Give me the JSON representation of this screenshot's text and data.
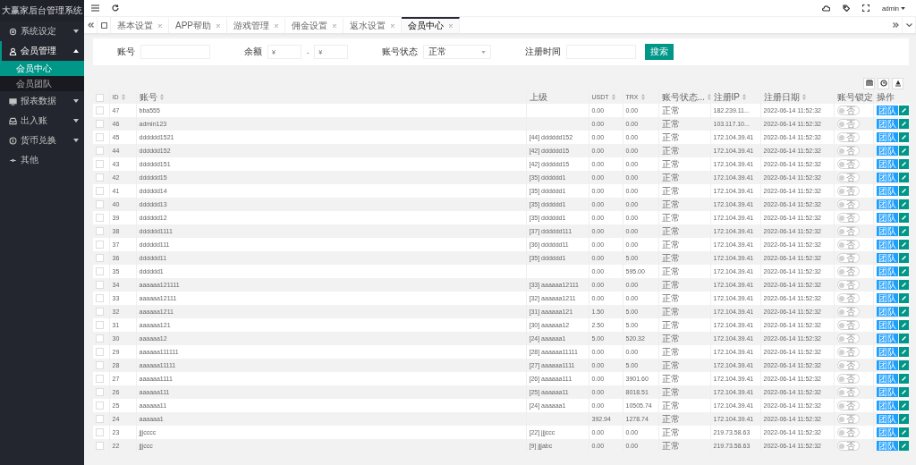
{
  "app": {
    "title": "大赢家后台管理系统"
  },
  "sidebar": {
    "items": [
      {
        "label": "系统设定",
        "kind": "group",
        "expanded": false
      },
      {
        "label": "会员管理",
        "kind": "group",
        "expanded": true,
        "children": [
          {
            "label": "会员中心",
            "selected": true
          },
          {
            "label": "会员团队",
            "selected": false
          }
        ]
      },
      {
        "label": "报表数据",
        "kind": "group",
        "expanded": false
      },
      {
        "label": "出入账",
        "kind": "group",
        "expanded": false
      },
      {
        "label": "货币兑换",
        "kind": "group",
        "expanded": false
      },
      {
        "label": "其他",
        "kind": "link"
      }
    ]
  },
  "header": {
    "user": "admin"
  },
  "tabs": [
    {
      "label": "基本设置",
      "selected": false
    },
    {
      "label": "APP帮助",
      "selected": false
    },
    {
      "label": "游戏管理",
      "selected": false
    },
    {
      "label": "佣金设置",
      "selected": false
    },
    {
      "label": "返水设置",
      "selected": false
    },
    {
      "label": "会员中心",
      "selected": true
    }
  ],
  "filter": {
    "fields": [
      {
        "label": "账号",
        "kind": "text"
      },
      {
        "label": "余额",
        "kind": "range",
        "from_placeholder": "¥",
        "separator": "-",
        "to_placeholder": "¥"
      },
      {
        "label": "账号状态",
        "kind": "select",
        "value": "正常"
      },
      {
        "label": "注册时间",
        "kind": "text"
      }
    ],
    "search_button": "搜索"
  },
  "table": {
    "header_checked": false,
    "columns": [
      {
        "label": "ID",
        "sortable": true
      },
      {
        "label": "账号",
        "sortable": true
      },
      {
        "label": "上级",
        "sortable": false
      },
      {
        "label": "USDT",
        "sortable": true
      },
      {
        "label": "TRX",
        "sortable": true
      },
      {
        "label": "账号状态...",
        "sortable": true
      },
      {
        "label": "注册IP",
        "sortable": true
      },
      {
        "label": "注册日期",
        "sortable": true
      },
      {
        "label": "账号锁定",
        "sortable": false
      },
      {
        "label": "操作",
        "sortable": false
      }
    ],
    "rows": [
      {
        "checked": false,
        "id": "47",
        "account": "bba555",
        "usdt": "0.00",
        "trx": "0.00",
        "status": "正常",
        "ip": "182.239.11...",
        "registered": "2022-06-14 11:52:32",
        "lock": {
          "on": false,
          "label": "否"
        },
        "action": "团队"
      },
      {
        "checked": false,
        "id": "46",
        "account": "admin123",
        "usdt": "0.00",
        "trx": "0.00",
        "status": "正常",
        "ip": "103.117.10...",
        "registered": "2022-06-14 11:52:32",
        "lock": {
          "on": false,
          "label": "否"
        },
        "action": "团队"
      },
      {
        "checked": false,
        "id": "45",
        "account": "dddddd1521",
        "upline": "[44] dddddd152",
        "usdt": "0.00",
        "trx": "0.00",
        "status": "正常",
        "ip": "172.104.39.41",
        "registered": "2022-06-14 11:52:32",
        "lock": {
          "on": false,
          "label": "否"
        },
        "action": "团队"
      },
      {
        "checked": false,
        "id": "44",
        "account": "dddddd152",
        "upline": "[42] dddddd15",
        "usdt": "0.00",
        "trx": "0.00",
        "status": "正常",
        "ip": "172.104.39.41",
        "registered": "2022-06-14 11:52:32",
        "lock": {
          "on": false,
          "label": "否"
        },
        "action": "团队"
      },
      {
        "checked": false,
        "id": "43",
        "account": "dddddd151",
        "upline": "[42] dddddd15",
        "usdt": "0.00",
        "trx": "0.00",
        "status": "正常",
        "ip": "172.104.39.41",
        "registered": "2022-06-14 11:52:32",
        "lock": {
          "on": false,
          "label": "否"
        },
        "action": "团队"
      },
      {
        "checked": false,
        "id": "42",
        "account": "dddddd15",
        "upline": "[35] dddddd1",
        "usdt": "0.00",
        "trx": "0.00",
        "status": "正常",
        "ip": "172.104.39.41",
        "registered": "2022-06-14 11:52:32",
        "lock": {
          "on": false,
          "label": "否"
        },
        "action": "团队"
      },
      {
        "checked": false,
        "id": "41",
        "account": "dddddd14",
        "upline": "[35] dddddd1",
        "usdt": "0.00",
        "trx": "0.00",
        "status": "正常",
        "ip": "172.104.39.41",
        "registered": "2022-06-14 11:52:32",
        "lock": {
          "on": false,
          "label": "否"
        },
        "action": "团队"
      },
      {
        "checked": false,
        "id": "40",
        "account": "dddddd13",
        "upline": "[35] dddddd1",
        "usdt": "0.00",
        "trx": "0.00",
        "status": "正常",
        "ip": "172.104.39.41",
        "registered": "2022-06-14 11:52:32",
        "lock": {
          "on": false,
          "label": "否"
        },
        "action": "团队"
      },
      {
        "checked": false,
        "id": "39",
        "account": "dddddd12",
        "upline": "[35] dddddd1",
        "usdt": "0.00",
        "trx": "0.00",
        "status": "正常",
        "ip": "172.104.39.41",
        "registered": "2022-06-14 11:52:32",
        "lock": {
          "on": false,
          "label": "否"
        },
        "action": "团队"
      },
      {
        "checked": false,
        "id": "38",
        "account": "dddddd1111",
        "upline": "[37] dddddd111",
        "usdt": "0.00",
        "trx": "0.00",
        "status": "正常",
        "ip": "172.104.39.41",
        "registered": "2022-06-14 11:52:32",
        "lock": {
          "on": false,
          "label": "否"
        },
        "action": "团队"
      },
      {
        "checked": false,
        "id": "37",
        "account": "dddddd111",
        "upline": "[36] dddddd11",
        "usdt": "0.00",
        "trx": "0.00",
        "status": "正常",
        "ip": "172.104.39.41",
        "registered": "2022-06-14 11:52:32",
        "lock": {
          "on": false,
          "label": "否"
        },
        "action": "团队"
      },
      {
        "checked": false,
        "id": "36",
        "account": "dddddd11",
        "upline": "[35] dddddd1",
        "usdt": "0.00",
        "trx": "5.00",
        "status": "正常",
        "ip": "172.104.39.41",
        "registered": "2022-06-14 11:52:32",
        "lock": {
          "on": false,
          "label": "否"
        },
        "action": "团队"
      },
      {
        "checked": false,
        "id": "35",
        "account": "dddddd1",
        "usdt": "0.00",
        "trx": "595.00",
        "status": "正常",
        "ip": "172.104.39.41",
        "registered": "2022-06-14 11:52:32",
        "lock": {
          "on": false,
          "label": "否"
        },
        "action": "团队"
      },
      {
        "checked": false,
        "id": "34",
        "account": "aaaaaa121111",
        "upline": "[33] aaaaaa12111",
        "usdt": "0.00",
        "trx": "0.00",
        "status": "正常",
        "ip": "172.104.39.41",
        "registered": "2022-06-14 11:52:32",
        "lock": {
          "on": false,
          "label": "否"
        },
        "action": "团队"
      },
      {
        "checked": false,
        "id": "33",
        "account": "aaaaaa12111",
        "upline": "[32] aaaaaa1211",
        "usdt": "0.00",
        "trx": "0.00",
        "status": "正常",
        "ip": "172.104.39.41",
        "registered": "2022-06-14 11:52:32",
        "lock": {
          "on": false,
          "label": "否"
        },
        "action": "团队"
      },
      {
        "checked": false,
        "id": "32",
        "account": "aaaaaa1211",
        "upline": "[31] aaaaaa121",
        "usdt": "1.50",
        "trx": "5.00",
        "status": "正常",
        "ip": "172.104.39.41",
        "registered": "2022-06-14 11:52:32",
        "lock": {
          "on": false,
          "label": "否"
        },
        "action": "团队"
      },
      {
        "checked": false,
        "id": "31",
        "account": "aaaaaa121",
        "upline": "[30] aaaaaa12",
        "usdt": "2.50",
        "trx": "5.00",
        "status": "正常",
        "ip": "172.104.39.41",
        "registered": "2022-06-14 11:52:32",
        "lock": {
          "on": false,
          "label": "否"
        },
        "action": "团队"
      },
      {
        "checked": false,
        "id": "30",
        "account": "aaaaaa12",
        "upline": "[24] aaaaaa1",
        "usdt": "5.00",
        "trx": "520.32",
        "status": "正常",
        "ip": "172.104.39.41",
        "registered": "2022-06-14 11:52:32",
        "lock": {
          "on": false,
          "label": "否"
        },
        "action": "团队"
      },
      {
        "checked": false,
        "id": "29",
        "account": "aaaaaa111111",
        "upline": "[28] aaaaaa11111",
        "usdt": "0.00",
        "trx": "0.00",
        "status": "正常",
        "ip": "172.104.39.41",
        "registered": "2022-06-14 11:52:32",
        "lock": {
          "on": false,
          "label": "否"
        },
        "action": "团队"
      },
      {
        "checked": false,
        "id": "28",
        "account": "aaaaaa11111",
        "upline": "[27] aaaaaa1111",
        "usdt": "0.00",
        "trx": "5.00",
        "status": "正常",
        "ip": "172.104.39.41",
        "registered": "2022-06-14 11:52:32",
        "lock": {
          "on": false,
          "label": "否"
        },
        "action": "团队"
      },
      {
        "checked": false,
        "id": "27",
        "account": "aaaaaa1111",
        "upline": "[26] aaaaaa111",
        "usdt": "0.00",
        "trx": "3901.60",
        "status": "正常",
        "ip": "172.104.39.41",
        "registered": "2022-06-14 11:52:32",
        "lock": {
          "on": false,
          "label": "否"
        },
        "action": "团队"
      },
      {
        "checked": false,
        "id": "26",
        "account": "aaaaaa111",
        "upline": "[25] aaaaaa11",
        "usdt": "0.00",
        "trx": "8018.51",
        "status": "正常",
        "ip": "172.104.39.41",
        "registered": "2022-06-14 11:52:32",
        "lock": {
          "on": false,
          "label": "否"
        },
        "action": "团队"
      },
      {
        "checked": false,
        "id": "25",
        "account": "aaaaaa11",
        "upline": "[24] aaaaaa1",
        "usdt": "0.00",
        "trx": "10505.74",
        "status": "正常",
        "ip": "172.104.39.41",
        "registered": "2022-06-14 11:52:32",
        "lock": {
          "on": false,
          "label": "否"
        },
        "action": "团队"
      },
      {
        "checked": false,
        "id": "24",
        "account": "aaaaaa1",
        "usdt": "392.94",
        "trx": "1278.74",
        "status": "正常",
        "ip": "172.104.39.41",
        "registered": "2022-06-14 11:52:32",
        "lock": {
          "on": false,
          "label": "否"
        },
        "action": "团队"
      },
      {
        "checked": false,
        "id": "23",
        "account": "jjjcccc",
        "upline": "[22] jjjccc",
        "usdt": "0.00",
        "trx": "0.00",
        "status": "正常",
        "ip": "219.73.58.63",
        "registered": "2022-06-14 11:52:32",
        "lock": {
          "on": false,
          "label": "否"
        },
        "action": "团队"
      },
      {
        "checked": false,
        "id": "22",
        "account": "jjjccc",
        "upline": "[9] jjjabc",
        "usdt": "0.00",
        "trx": "0.00",
        "status": "正常",
        "ip": "219.73.58.63",
        "registered": "2022-06-14 11:52:32",
        "lock": {
          "on": false,
          "label": "否"
        },
        "action": "团队"
      }
    ]
  }
}
